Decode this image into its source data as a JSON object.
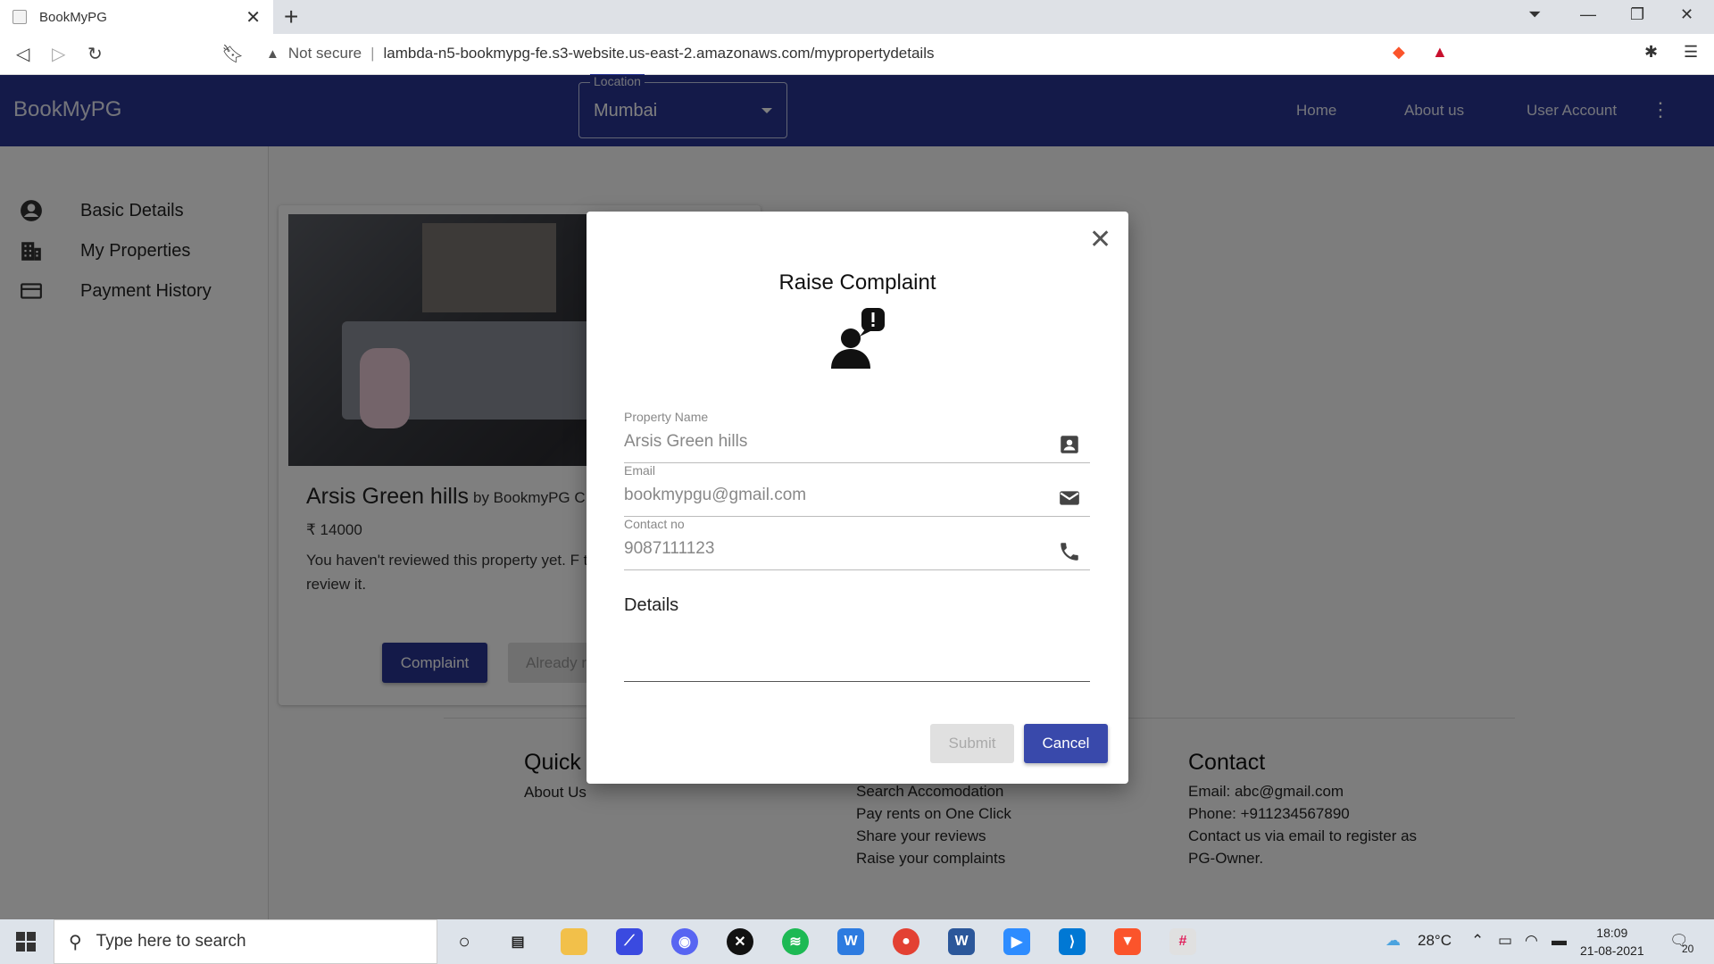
{
  "browser": {
    "tab_title": "BookMyPG",
    "close_tab": "✕",
    "new_tab": "+",
    "not_secure": "Not secure",
    "url": "lambda-n5-bookmypg-fe.s3-website.us-east-2.amazonaws.com/mypropertydetails"
  },
  "app": {
    "brand": "BookMyPG",
    "location_label": "Location",
    "location_value": "Mumbai",
    "nav": [
      "Home",
      "About us",
      "User Account"
    ]
  },
  "sidebar": {
    "items": [
      {
        "label": "Basic Details",
        "icon": "account-circle-icon"
      },
      {
        "label": "My Properties",
        "icon": "building-icon"
      },
      {
        "label": "Payment History",
        "icon": "credit-card-icon"
      }
    ]
  },
  "card": {
    "title": "Arsis Green hills",
    "by": "by BookmyPG C",
    "price": "₹ 14000",
    "note": "You haven't reviewed this property yet. F to review it.",
    "complaint_button": "Complaint",
    "already_button": "Already r"
  },
  "footer": {
    "quick_heading": "Quick",
    "quick_links": [
      "About Us"
    ],
    "services": [
      "Search Accomodation",
      "Pay rents on One Click",
      "Share your reviews",
      "Raise your complaints"
    ],
    "contact_heading": "Contact",
    "contact_lines": [
      "Email: abc@gmail.com",
      "Phone: +911234567890",
      "Contact us via email to register as",
      "PG-Owner."
    ]
  },
  "modal": {
    "title": "Raise Complaint",
    "fields": [
      {
        "label": "Property Name",
        "value": "Arsis Green hills",
        "icon": "contact-card-icon"
      },
      {
        "label": "Email",
        "value": "bookmypgu@gmail.com",
        "icon": "mail-icon"
      },
      {
        "label": "Contact no",
        "value": "9087111123",
        "icon": "phone-icon"
      }
    ],
    "details_label": "Details",
    "submit": "Submit",
    "cancel": "Cancel"
  },
  "taskbar": {
    "search_placeholder": "Type here to search",
    "temperature": "28°C",
    "time": "18:09",
    "date": "21-08-2021",
    "notifications": "20"
  }
}
